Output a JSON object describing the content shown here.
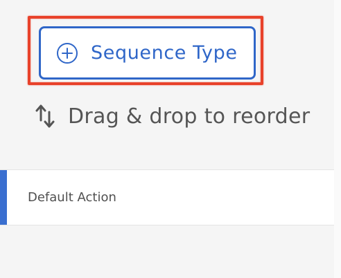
{
  "toolbar": {
    "add_button_label": "Sequence Type",
    "add_button_icon": "plus-circle-icon"
  },
  "reorder": {
    "hint": "Drag & drop to reorder",
    "icon": "sort-arrows-icon"
  },
  "actions": [
    {
      "label": "Default Action",
      "selected": true
    }
  ],
  "colors": {
    "accent": "#2f66c8",
    "highlight": "#e8412a",
    "background": "#f5f5f5"
  }
}
